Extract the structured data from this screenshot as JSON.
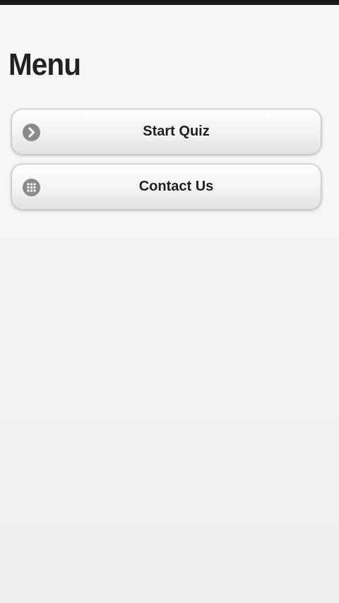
{
  "page": {
    "title": "Menu"
  },
  "menu": {
    "items": [
      {
        "label": "Start Quiz",
        "icon": "arrow-right-icon"
      },
      {
        "label": "Contact Us",
        "icon": "grid-icon"
      }
    ]
  },
  "colors": {
    "status_bar": "#1a1a1a",
    "icon_bg": "#8a8a8a",
    "text": "#222222"
  }
}
